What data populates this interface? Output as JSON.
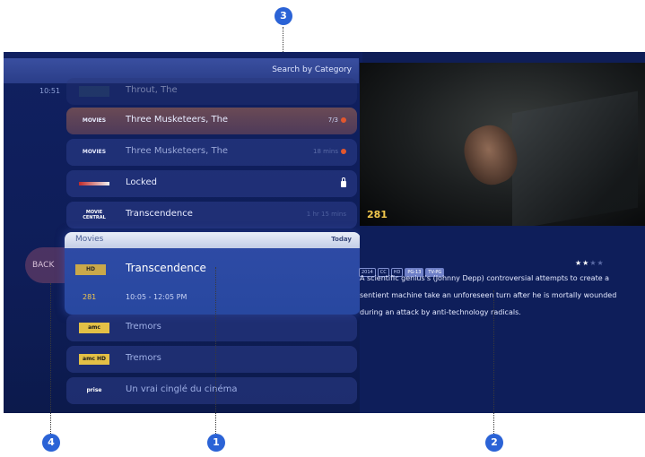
{
  "header": {
    "search_label": "Search by Category"
  },
  "guide": {
    "time": "10:51",
    "rows": [
      {
        "logo": "",
        "title": "Throut, The",
        "right": "",
        "style": "dim"
      },
      {
        "logo": "MOVIES",
        "title": "Three Musketeers, The",
        "right": "7/3",
        "style": "selected"
      },
      {
        "logo": "MOVIES",
        "title": "Three Musketeers, The",
        "right": "18 mins",
        "style": "faded"
      },
      {
        "logo": "",
        "title": "Locked",
        "right": "",
        "style": "normal"
      },
      {
        "logo": "MOVIE CENTRAL",
        "title": "Transcendence",
        "right": "1 hr 15 mins",
        "style": "normal"
      }
    ],
    "lower_rows": [
      {
        "logo": "amc",
        "title": "Tremors"
      },
      {
        "logo": "amc HD",
        "title": "Tremors"
      },
      {
        "logo": "prise",
        "title": "Un vrai cinglé du cinéma"
      }
    ]
  },
  "back_label": "BACK",
  "focus": {
    "category": "Movies",
    "day": "Today",
    "logo": "HD",
    "title": "Transcendence",
    "channel": "281",
    "time": "10:05 - 12:05 PM"
  },
  "preview": {
    "channel": "281"
  },
  "details": {
    "tags": [
      "2014",
      "CC",
      "HD",
      "PG-13",
      "TV-PG"
    ],
    "stars_on": "★★",
    "stars_off": "★★",
    "description": "A scientific genius's (Johnny Depp) controversial attempts to create a sentient machine take an unforeseen turn after he is mortally wounded during an attack by anti-technology radicals."
  },
  "callouts": {
    "c1": "1",
    "c2": "2",
    "c3": "3",
    "c4": "4"
  },
  "colors": {
    "callout": "#2b63d6",
    "accent_gold": "#f2c84d",
    "background": "#0f1e57"
  }
}
